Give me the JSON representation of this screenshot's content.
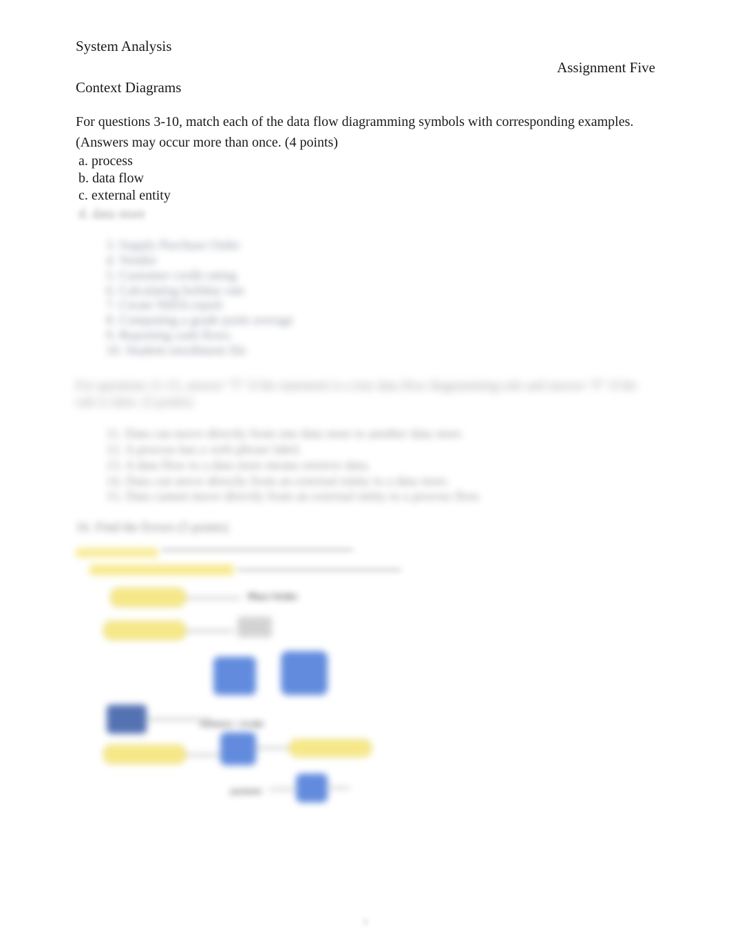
{
  "header": {
    "course": "System Analysis",
    "assignment": "Assignment Five",
    "topic": "Context Diagrams"
  },
  "instructions": {
    "line1": "For questions 3-10, match each of the data flow diagramming symbols with corresponding examples.",
    "line2": "(Answers may occur more than once. (4 points)",
    "optA": " a. process",
    "optB": " b. data flow",
    "optC": " c. external entity",
    "optD": " d. data store"
  },
  "list1": {
    "i3": "3.    Supply Purchase Order",
    "i4": "4.    Vendor",
    "i5": "5.    Customer credit rating",
    "i6": "6.    Calculating holiday rate",
    "i7": "7.    Create NIDA report",
    "i8": "8.    Computing a grade point average",
    "i9": "9.    Reporting cash flows",
    "i10": "10.  Student enrollment file"
  },
  "paragraph": "For questions 11-15, answer \"T\" if the statement is a true data flow diagramming rule and answer \"F\" if the rule is false. (5 points)",
  "list2": {
    "i11": "11.  Data can move directly from one data store to another data store.",
    "i12": "12.  A process has a verb phrase label.",
    "i13": "13.  A data flow to a data store means retrieve data.",
    "i14": "14.  Data can move directly from an external entity to a data store.",
    "i15": "15.  Data cannot move directly from an external entity to a process flow."
  },
  "section16": "16.  Find the Errors (5 points)",
  "pageNumber": "9"
}
